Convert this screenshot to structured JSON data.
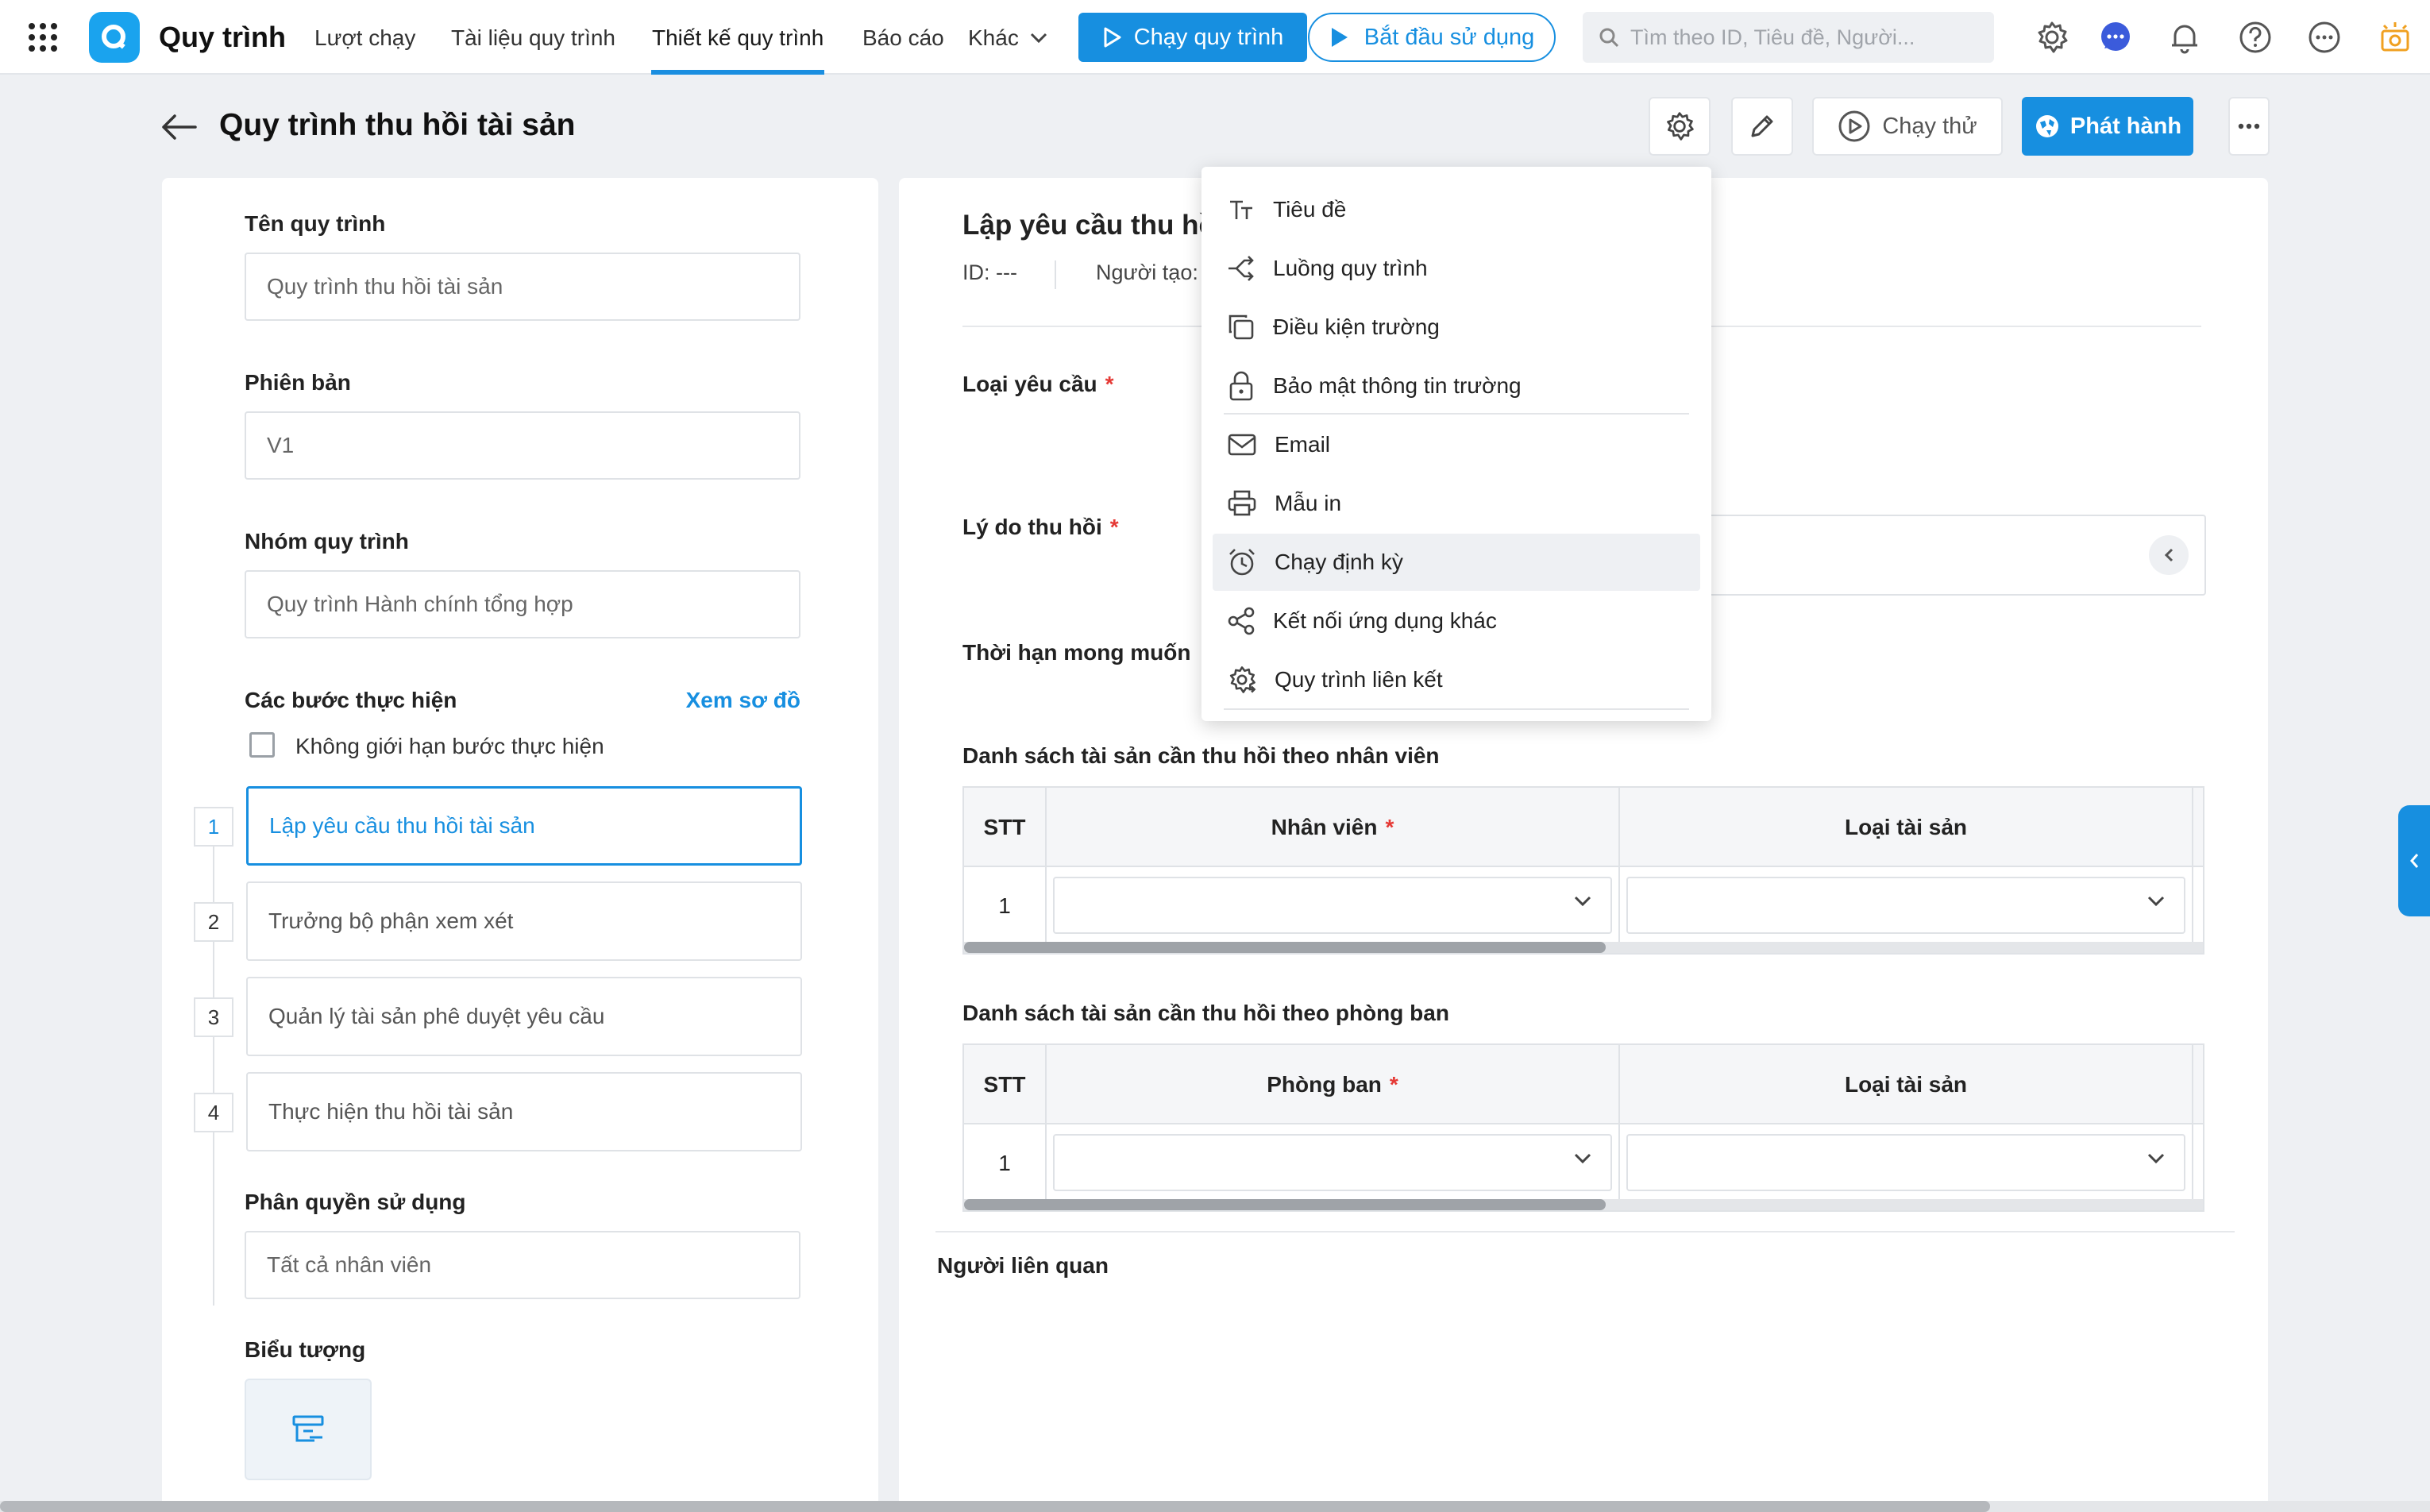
{
  "app": {
    "name": "Quy trình",
    "colors": {
      "accent": "#178fe0",
      "required": "#e53935",
      "brand": "#1aa3ee"
    }
  },
  "nav": {
    "items": [
      "Lượt chạy",
      "Tài liệu quy trình",
      "Thiết kế quy trình",
      "Báo cáo",
      "Khác"
    ],
    "active": "Thiết kế quy trình"
  },
  "topbar": {
    "run_label": "Chạy quy trình",
    "start_label": "Bắt đầu sử dụng",
    "search_placeholder": "Tìm theo ID, Tiêu đề, Người..."
  },
  "page": {
    "title": "Quy trình thu hồi tài sản",
    "try_label": "Chạy thử",
    "publish_label": "Phát hành"
  },
  "left": {
    "name_label": "Tên quy trình",
    "name_value": "Quy trình thu hồi tài sản",
    "version_label": "Phiên bản",
    "version_value": "V1",
    "group_label": "Nhóm quy trình",
    "group_value": "Quy trình Hành chính tổng hợp",
    "steps_label": "Các bước thực hiện",
    "diagram_link": "Xem sơ đồ",
    "unlimited_label": "Không giới hạn bước thực hiện",
    "steps": [
      {
        "num": "1",
        "label": "Lập yêu cầu thu hồi tài sản"
      },
      {
        "num": "2",
        "label": "Trưởng bộ phận xem xét"
      },
      {
        "num": "3",
        "label": "Quản lý tài sản phê duyệt yêu cầu"
      },
      {
        "num": "4",
        "label": "Thực hiện thu hồi tài sản"
      }
    ],
    "permission_label": "Phân quyền sử dụng",
    "permission_value": "Tất cả nhân viên",
    "icon_label": "Biểu tượng"
  },
  "form": {
    "title": "Lập yêu cầu thu hồ",
    "id_label": "ID: ---",
    "creator_label": "Người tạo:",
    "request_type_label": "Loại yêu cầu",
    "reason_label": "Lý do thu hồi",
    "deadline_label": "Thời hạn mong muốn",
    "required_mark": "*",
    "table1": {
      "title": "Danh sách tài sản cần thu hồi theo nhân viên",
      "headers": [
        "STT",
        "Nhân viên",
        "Loại tài sản"
      ],
      "row_num": "1"
    },
    "table2": {
      "title": "Danh sách tài sản cần thu hồi theo phòng ban",
      "headers": [
        "STT",
        "Phòng ban",
        "Loại tài sản"
      ],
      "row_num": "1"
    },
    "related_label": "Người liên quan"
  },
  "menu": {
    "items": [
      {
        "label": "Tiêu đề",
        "icon": "text-icon"
      },
      {
        "label": "Luồng quy trình",
        "icon": "flow-icon"
      },
      {
        "label": "Điều kiện trường",
        "icon": "copy-icon"
      },
      {
        "label": "Bảo mật thông tin trường",
        "icon": "lock-icon"
      },
      {
        "label": "Email",
        "icon": "mail-icon"
      },
      {
        "label": "Mẫu in",
        "icon": "printer-icon"
      },
      {
        "label": "Chạy định kỳ",
        "icon": "alarm-icon"
      },
      {
        "label": "Kết nối ứng dụng khác",
        "icon": "share-icon"
      },
      {
        "label": "Quy trình liên kết",
        "icon": "gear-link-icon"
      }
    ],
    "hovered": "Chạy định kỳ"
  }
}
